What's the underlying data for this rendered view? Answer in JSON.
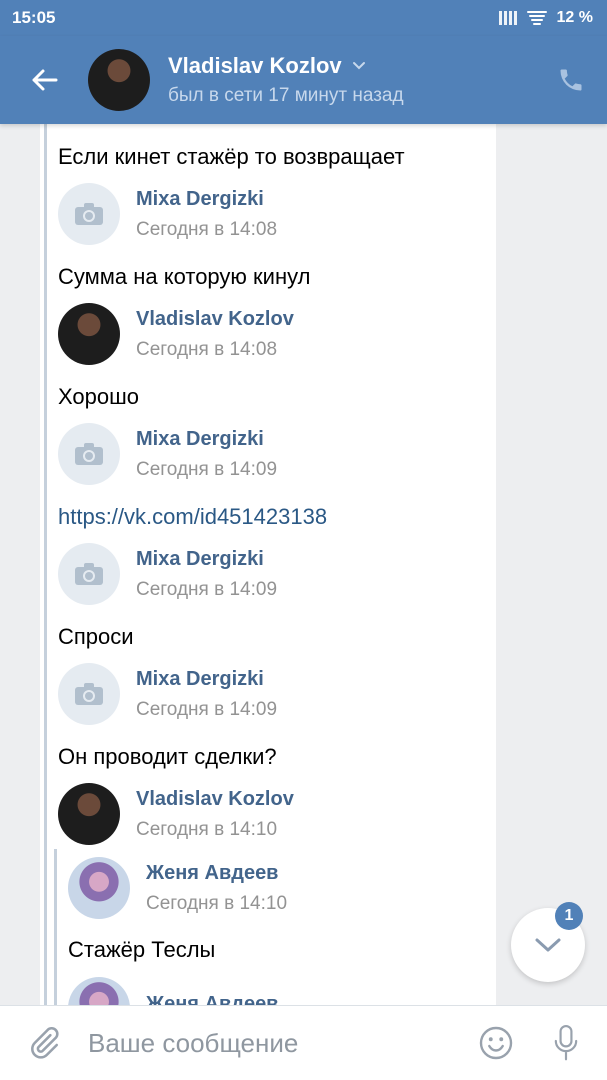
{
  "status_bar": {
    "time": "15:05",
    "battery": "12 %"
  },
  "header": {
    "name": "Vladislav Kozlov",
    "status": "был в сети 17 минут назад"
  },
  "messages": [
    {
      "type": "text",
      "text": "Если кинет стажёр то возвращает"
    },
    {
      "type": "sender",
      "name": "Mixa Dergizki",
      "time": "Сегодня в 14:08",
      "avatar": "camera-icon"
    },
    {
      "type": "text",
      "text": "Сумма на которую кинул"
    },
    {
      "type": "sender",
      "name": "Vladislav Kozlov",
      "time": "Сегодня в 14:08",
      "avatar": "photo"
    },
    {
      "type": "text",
      "text": "Хорошо"
    },
    {
      "type": "sender",
      "name": "Mixa Dergizki",
      "time": "Сегодня в 14:09",
      "avatar": "camera-icon"
    },
    {
      "type": "link",
      "text": "https://vk.com/id451423138"
    },
    {
      "type": "sender",
      "name": "Mixa Dergizki",
      "time": "Сегодня в 14:09",
      "avatar": "camera-icon"
    },
    {
      "type": "text",
      "text": "Спроси"
    },
    {
      "type": "sender",
      "name": "Mixa Dergizki",
      "time": "Сегодня в 14:09",
      "avatar": "camera-icon"
    },
    {
      "type": "text",
      "text": "Он проводит сделки?"
    },
    {
      "type": "sender",
      "name": "Vladislav Kozlov",
      "time": "Сегодня в 14:10",
      "avatar": "photo"
    },
    {
      "type": "sender",
      "name": "Женя Авдеев",
      "time": "Сегодня в 14:10",
      "avatar": "photo"
    },
    {
      "type": "text",
      "text": "Стажёр Теслы"
    },
    {
      "type": "sender",
      "name": "Женя Авдеев",
      "time": "",
      "avatar": "photo"
    }
  ],
  "scroll_down": {
    "badge_count": "1"
  },
  "composer": {
    "placeholder": "Ваше сообщение"
  },
  "colors": {
    "header": "#5181b8",
    "name": "#42648b",
    "link": "#2a5885",
    "muted": "#939393"
  }
}
